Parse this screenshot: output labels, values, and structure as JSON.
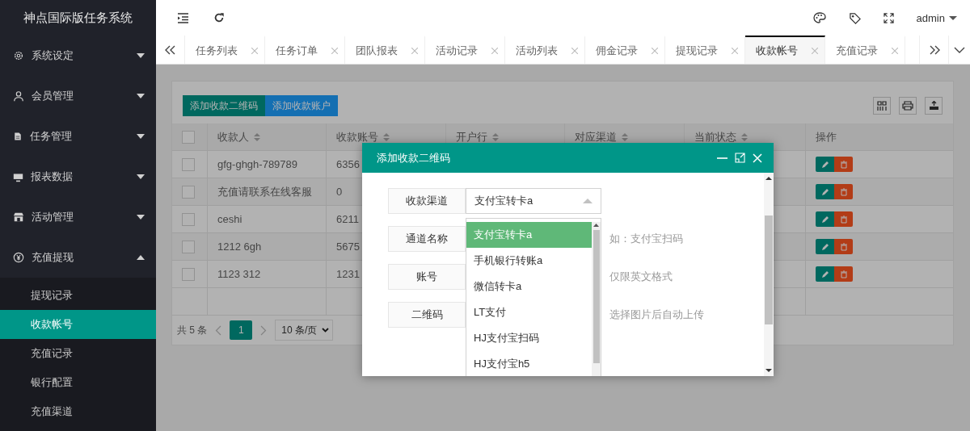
{
  "app_title": "神点国际版任务系统",
  "header": {
    "user": "admin"
  },
  "tabs": [
    {
      "label": "任务列表",
      "selected": false
    },
    {
      "label": "任务订单",
      "selected": false
    },
    {
      "label": "团队报表",
      "selected": false
    },
    {
      "label": "活动记录",
      "selected": false
    },
    {
      "label": "活动列表",
      "selected": false
    },
    {
      "label": "佣金记录",
      "selected": false
    },
    {
      "label": "提现记录",
      "selected": false
    },
    {
      "label": "收款帐号",
      "selected": true
    },
    {
      "label": "充值记录",
      "selected": false
    }
  ],
  "sidebar": {
    "items": [
      {
        "label": "系统设定",
        "expanded": false
      },
      {
        "label": "会员管理",
        "expanded": false
      },
      {
        "label": "任务管理",
        "expanded": false
      },
      {
        "label": "报表数据",
        "expanded": false
      },
      {
        "label": "活动管理",
        "expanded": false
      },
      {
        "label": "充值提现",
        "expanded": true,
        "children": [
          {
            "label": "提现记录",
            "selected": false
          },
          {
            "label": "收款帐号",
            "selected": true
          },
          {
            "label": "充值记录",
            "selected": false
          },
          {
            "label": "银行配置",
            "selected": false
          },
          {
            "label": "充值渠道",
            "selected": false
          }
        ]
      }
    ]
  },
  "toolbar": {
    "buttons": [
      "添加收款二维码",
      "添加收款账户"
    ]
  },
  "table": {
    "header_checked": false,
    "columns": [
      {
        "label": "收款人",
        "sortable": true
      },
      {
        "label": "收款账号",
        "sortable": true
      },
      {
        "label": "开户行",
        "sortable": true
      },
      {
        "label": "对应渠道",
        "sortable": true
      },
      {
        "label": "当前状态",
        "sortable": true
      },
      {
        "label": "操作",
        "sortable": false
      }
    ],
    "rows": [
      {
        "checked": false,
        "cells": [
          "gfg-ghgh-789789",
          "6356"
        ]
      },
      {
        "checked": false,
        "cells": [
          "充值请联系在线客服",
          "0"
        ]
      },
      {
        "checked": false,
        "cells": [
          "ceshi",
          "6211"
        ]
      },
      {
        "checked": false,
        "cells": [
          "1212 6gh",
          "5675"
        ]
      },
      {
        "checked": false,
        "cells": [
          "1123 312",
          "1231"
        ]
      }
    ],
    "pagination": {
      "total": "共 5 条",
      "page": "1",
      "page_size": "10 条/页"
    }
  },
  "dialog": {
    "title": "添加收款二维码",
    "fields": [
      {
        "kind": "select",
        "label": "收款渠道",
        "value": "支付宝转卡a"
      },
      {
        "kind": "input",
        "label": "通道名称",
        "hint": "如：支付宝扫码"
      },
      {
        "kind": "input",
        "label": "账号",
        "hint": "仅限英文格式"
      },
      {
        "kind": "upload",
        "label": "二维码",
        "hint": "选择图片后自动上传"
      }
    ],
    "dropdown": {
      "options": [
        {
          "label": "支付宝转卡a",
          "selected": true
        },
        {
          "label": "手机银行转账a",
          "selected": false
        },
        {
          "label": "微信转卡a",
          "selected": false
        },
        {
          "label": "LT支付",
          "selected": false
        },
        {
          "label": "HJ支付宝扫码",
          "selected": false
        },
        {
          "label": "HJ支付宝h5",
          "selected": false
        }
      ]
    }
  }
}
